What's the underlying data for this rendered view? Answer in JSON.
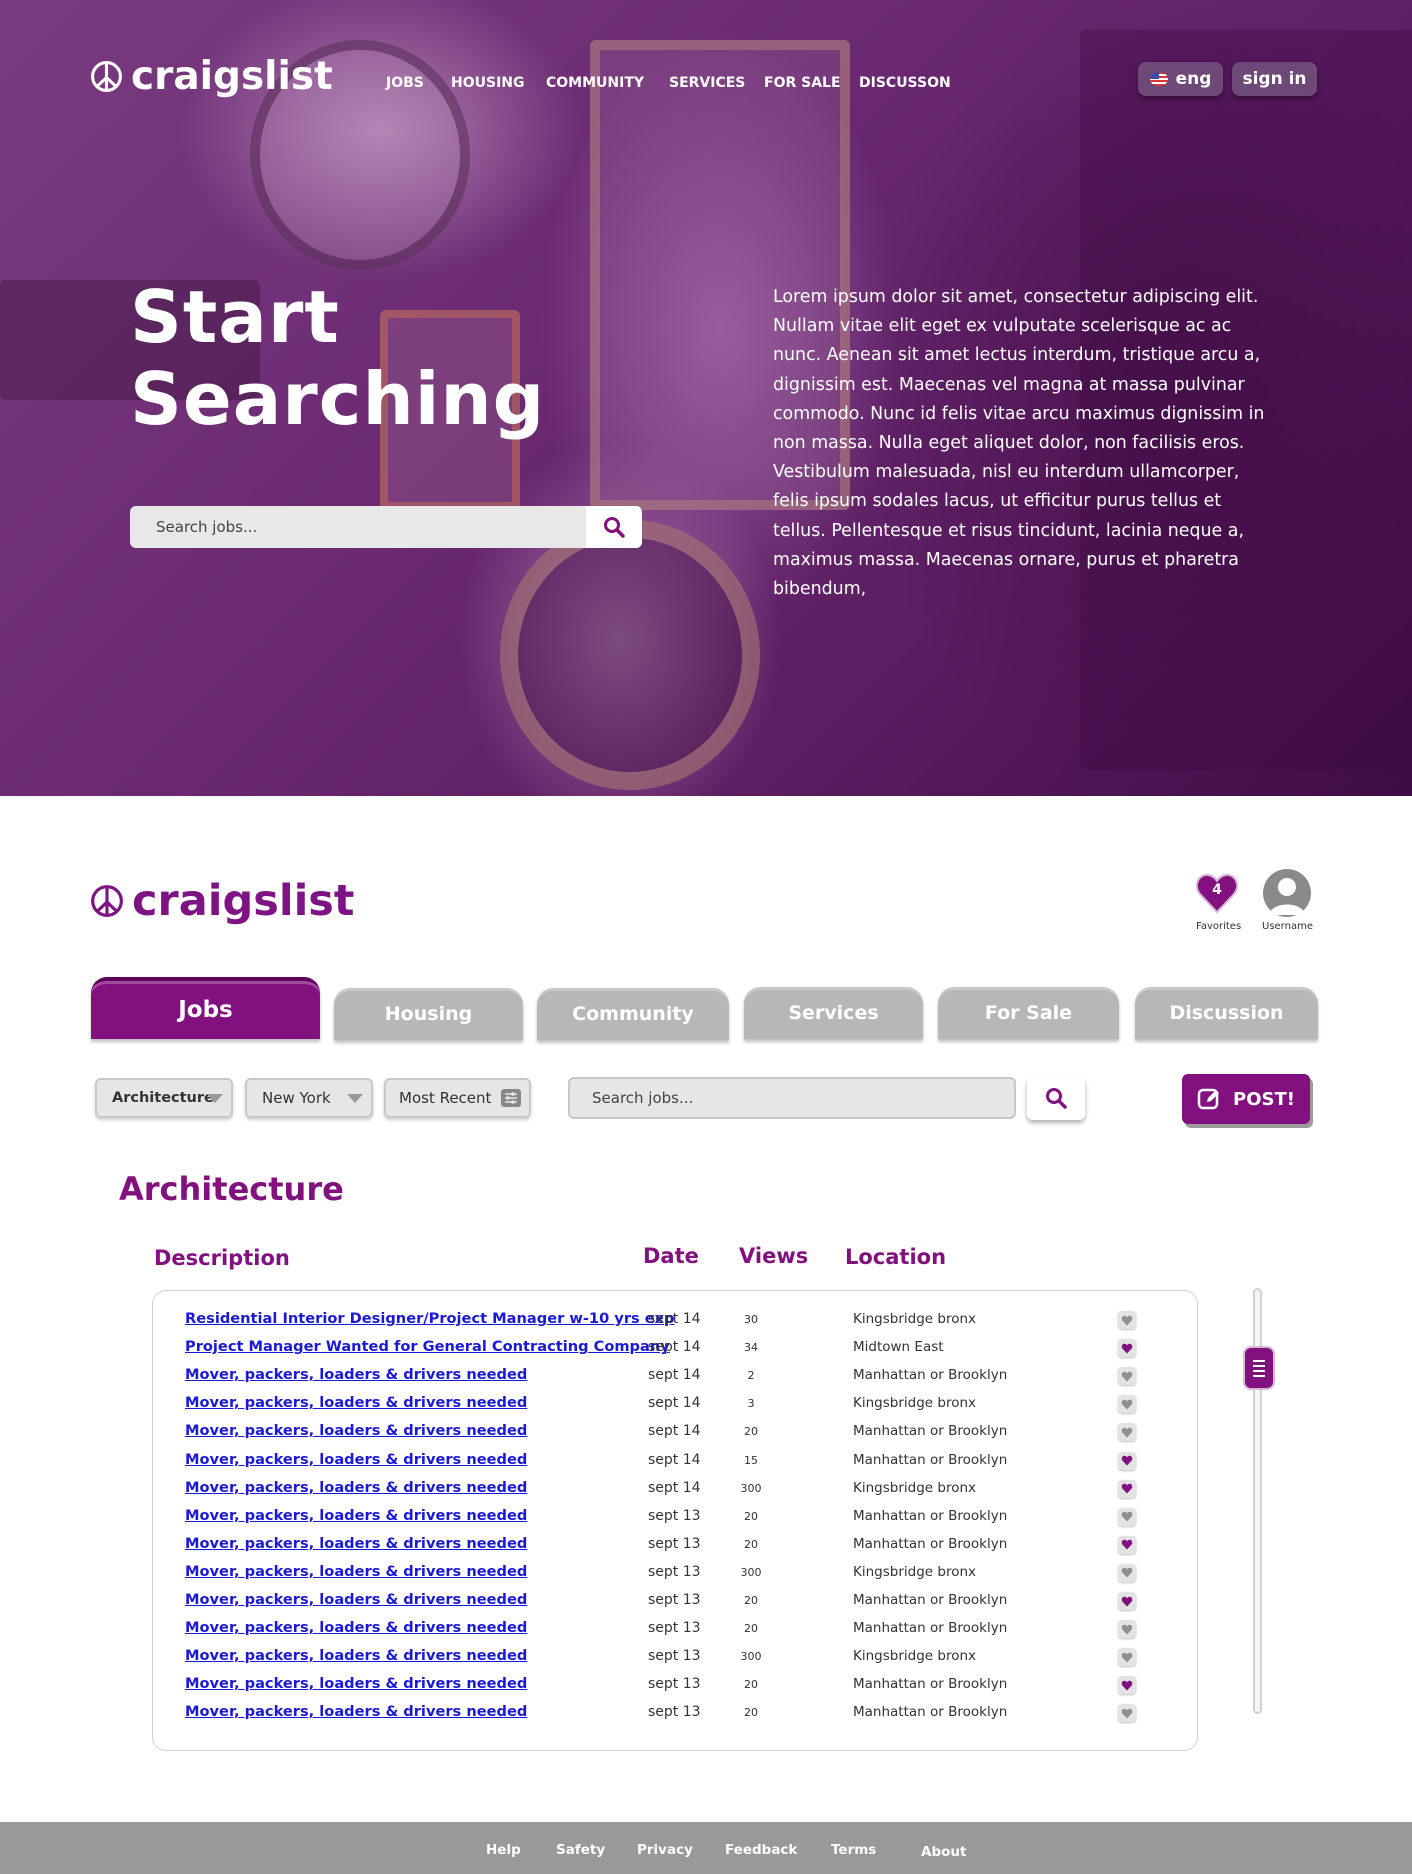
{
  "brand": {
    "name": "craigslist"
  },
  "hero": {
    "nav": [
      "JOBS",
      "HOUSING",
      "COMMUNITY",
      "SERVICES",
      "FOR SALE",
      "DISCUSSON"
    ],
    "lang_label": "eng",
    "signin_label": "sign in",
    "title_line1": "Start",
    "title_line2": "Searching",
    "search_placeholder": "Search jobs...",
    "body_text": "Lorem ipsum dolor sit amet, consectetur adipiscing elit. Nullam vitae elit eget ex vulputate scelerisque ac ac nunc. Aenean sit amet lectus interdum, tristique arcu a, dignissim est. Maecenas vel magna at massa pulvinar commodo. Nunc id felis vitae arcu maximus dignissim in non massa. Nulla eget aliquet dolor, non facilisis eros. Vestibulum malesuada, nisl eu interdum ullamcorper, felis ipsum sodales lacus, ut efficitur purus tellus et tellus. Pellentesque et risus tincidunt, lacinia neque a, maximus massa. Maecenas ornare, purus et pharetra bibendum,"
  },
  "header": {
    "favorites_count": "4",
    "favorites_label": "Favorites",
    "username_label": "Username"
  },
  "tabs": [
    {
      "label": "Jobs",
      "active": true
    },
    {
      "label": "Housing",
      "active": false
    },
    {
      "label": "Community",
      "active": false
    },
    {
      "label": "Services",
      "active": false
    },
    {
      "label": "For Sale",
      "active": false
    },
    {
      "label": "Discussion",
      "active": false
    }
  ],
  "filters": {
    "category": "Architecture",
    "location": "New York",
    "sort": "Most Recent",
    "search_placeholder": "Search jobs...",
    "post_label": "POST!"
  },
  "listing": {
    "section_title": "Architecture",
    "columns": {
      "description": "Description",
      "date": "Date",
      "views": "Views",
      "location": "Location"
    },
    "rows": [
      {
        "description": "Residential Interior Designer/Project Manager w-10 yrs exp",
        "date": "sept 14",
        "views": "30",
        "location": "Kingsbridge bronx",
        "favorited": false
      },
      {
        "description": "Project Manager Wanted for General Contracting Company",
        "date": "sept 14",
        "views": "34",
        "location": "Midtown East",
        "favorited": true
      },
      {
        "description": "Mover, packers, loaders & drivers needed",
        "date": "sept 14",
        "views": "2",
        "location": "Manhattan or Brooklyn",
        "favorited": false
      },
      {
        "description": "Mover, packers, loaders & drivers needed",
        "date": "sept 14",
        "views": "3",
        "location": "Kingsbridge bronx",
        "favorited": false
      },
      {
        "description": "Mover, packers, loaders & drivers needed",
        "date": "sept 14",
        "views": "20",
        "location": "Manhattan or Brooklyn",
        "favorited": false
      },
      {
        "description": "Mover, packers, loaders & drivers needed",
        "date": "sept 14",
        "views": "15",
        "location": "Manhattan or Brooklyn",
        "favorited": true
      },
      {
        "description": "Mover, packers, loaders & drivers needed",
        "date": "sept 14",
        "views": "300",
        "location": "Kingsbridge bronx",
        "favorited": true
      },
      {
        "description": "Mover, packers, loaders & drivers needed",
        "date": "sept 13",
        "views": "20",
        "location": "Manhattan or Brooklyn",
        "favorited": false
      },
      {
        "description": "Mover, packers, loaders & drivers needed",
        "date": "sept 13",
        "views": "20",
        "location": "Manhattan or Brooklyn",
        "favorited": true
      },
      {
        "description": "Mover, packers, loaders & drivers needed",
        "date": "sept 13",
        "views": "300",
        "location": "Kingsbridge bronx",
        "favorited": false
      },
      {
        "description": "Mover, packers, loaders & drivers needed",
        "date": "sept 13",
        "views": "20",
        "location": "Manhattan or Brooklyn",
        "favorited": true
      },
      {
        "description": "Mover, packers, loaders & drivers needed",
        "date": "sept 13",
        "views": "20",
        "location": "Manhattan or Brooklyn",
        "favorited": false
      },
      {
        "description": "Mover, packers, loaders & drivers needed",
        "date": "sept 13",
        "views": "300",
        "location": "Kingsbridge bronx",
        "favorited": false
      },
      {
        "description": "Mover, packers, loaders & drivers needed",
        "date": "sept 13",
        "views": "20",
        "location": "Manhattan or Brooklyn",
        "favorited": true
      },
      {
        "description": "Mover, packers, loaders & drivers needed",
        "date": "sept 13",
        "views": "20",
        "location": "Manhattan or Brooklyn",
        "favorited": false
      }
    ]
  },
  "footer": {
    "links": [
      "Help",
      "Safety",
      "Privacy",
      "Feedback",
      "Terms",
      "About"
    ]
  },
  "colors": {
    "accent": "#82107f",
    "tab_inactive": "#b7b7b7",
    "link": "#1a1ad6",
    "footer": "#999999"
  }
}
